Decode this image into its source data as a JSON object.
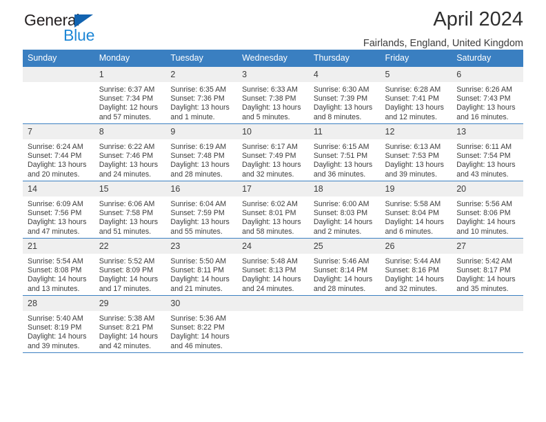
{
  "brand": {
    "line1": "General",
    "line2": "Blue",
    "triangle_icon": "triangle-icon",
    "color_dark": "#231f20",
    "color_blue": "#1e87d6"
  },
  "header": {
    "title": "April 2024",
    "subtitle": "Fairlands, England, United Kingdom"
  },
  "theme": {
    "header_blue": "#3a7fc1",
    "daynum_gray": "#efefef",
    "text": "#3b3b3b"
  },
  "weekday_headers": [
    "Sunday",
    "Monday",
    "Tuesday",
    "Wednesday",
    "Thursday",
    "Friday",
    "Saturday"
  ],
  "weeks": [
    [
      {
        "day": "",
        "sunrise": "",
        "sunset": "",
        "daylight1": "",
        "daylight2": ""
      },
      {
        "day": "1",
        "sunrise": "Sunrise: 6:37 AM",
        "sunset": "Sunset: 7:34 PM",
        "daylight1": "Daylight: 12 hours",
        "daylight2": "and 57 minutes."
      },
      {
        "day": "2",
        "sunrise": "Sunrise: 6:35 AM",
        "sunset": "Sunset: 7:36 PM",
        "daylight1": "Daylight: 13 hours",
        "daylight2": "and 1 minute."
      },
      {
        "day": "3",
        "sunrise": "Sunrise: 6:33 AM",
        "sunset": "Sunset: 7:38 PM",
        "daylight1": "Daylight: 13 hours",
        "daylight2": "and 5 minutes."
      },
      {
        "day": "4",
        "sunrise": "Sunrise: 6:30 AM",
        "sunset": "Sunset: 7:39 PM",
        "daylight1": "Daylight: 13 hours",
        "daylight2": "and 8 minutes."
      },
      {
        "day": "5",
        "sunrise": "Sunrise: 6:28 AM",
        "sunset": "Sunset: 7:41 PM",
        "daylight1": "Daylight: 13 hours",
        "daylight2": "and 12 minutes."
      },
      {
        "day": "6",
        "sunrise": "Sunrise: 6:26 AM",
        "sunset": "Sunset: 7:43 PM",
        "daylight1": "Daylight: 13 hours",
        "daylight2": "and 16 minutes."
      }
    ],
    [
      {
        "day": "7",
        "sunrise": "Sunrise: 6:24 AM",
        "sunset": "Sunset: 7:44 PM",
        "daylight1": "Daylight: 13 hours",
        "daylight2": "and 20 minutes."
      },
      {
        "day": "8",
        "sunrise": "Sunrise: 6:22 AM",
        "sunset": "Sunset: 7:46 PM",
        "daylight1": "Daylight: 13 hours",
        "daylight2": "and 24 minutes."
      },
      {
        "day": "9",
        "sunrise": "Sunrise: 6:19 AM",
        "sunset": "Sunset: 7:48 PM",
        "daylight1": "Daylight: 13 hours",
        "daylight2": "and 28 minutes."
      },
      {
        "day": "10",
        "sunrise": "Sunrise: 6:17 AM",
        "sunset": "Sunset: 7:49 PM",
        "daylight1": "Daylight: 13 hours",
        "daylight2": "and 32 minutes."
      },
      {
        "day": "11",
        "sunrise": "Sunrise: 6:15 AM",
        "sunset": "Sunset: 7:51 PM",
        "daylight1": "Daylight: 13 hours",
        "daylight2": "and 36 minutes."
      },
      {
        "day": "12",
        "sunrise": "Sunrise: 6:13 AM",
        "sunset": "Sunset: 7:53 PM",
        "daylight1": "Daylight: 13 hours",
        "daylight2": "and 39 minutes."
      },
      {
        "day": "13",
        "sunrise": "Sunrise: 6:11 AM",
        "sunset": "Sunset: 7:54 PM",
        "daylight1": "Daylight: 13 hours",
        "daylight2": "and 43 minutes."
      }
    ],
    [
      {
        "day": "14",
        "sunrise": "Sunrise: 6:09 AM",
        "sunset": "Sunset: 7:56 PM",
        "daylight1": "Daylight: 13 hours",
        "daylight2": "and 47 minutes."
      },
      {
        "day": "15",
        "sunrise": "Sunrise: 6:06 AM",
        "sunset": "Sunset: 7:58 PM",
        "daylight1": "Daylight: 13 hours",
        "daylight2": "and 51 minutes."
      },
      {
        "day": "16",
        "sunrise": "Sunrise: 6:04 AM",
        "sunset": "Sunset: 7:59 PM",
        "daylight1": "Daylight: 13 hours",
        "daylight2": "and 55 minutes."
      },
      {
        "day": "17",
        "sunrise": "Sunrise: 6:02 AM",
        "sunset": "Sunset: 8:01 PM",
        "daylight1": "Daylight: 13 hours",
        "daylight2": "and 58 minutes."
      },
      {
        "day": "18",
        "sunrise": "Sunrise: 6:00 AM",
        "sunset": "Sunset: 8:03 PM",
        "daylight1": "Daylight: 14 hours",
        "daylight2": "and 2 minutes."
      },
      {
        "day": "19",
        "sunrise": "Sunrise: 5:58 AM",
        "sunset": "Sunset: 8:04 PM",
        "daylight1": "Daylight: 14 hours",
        "daylight2": "and 6 minutes."
      },
      {
        "day": "20",
        "sunrise": "Sunrise: 5:56 AM",
        "sunset": "Sunset: 8:06 PM",
        "daylight1": "Daylight: 14 hours",
        "daylight2": "and 10 minutes."
      }
    ],
    [
      {
        "day": "21",
        "sunrise": "Sunrise: 5:54 AM",
        "sunset": "Sunset: 8:08 PM",
        "daylight1": "Daylight: 14 hours",
        "daylight2": "and 13 minutes."
      },
      {
        "day": "22",
        "sunrise": "Sunrise: 5:52 AM",
        "sunset": "Sunset: 8:09 PM",
        "daylight1": "Daylight: 14 hours",
        "daylight2": "and 17 minutes."
      },
      {
        "day": "23",
        "sunrise": "Sunrise: 5:50 AM",
        "sunset": "Sunset: 8:11 PM",
        "daylight1": "Daylight: 14 hours",
        "daylight2": "and 21 minutes."
      },
      {
        "day": "24",
        "sunrise": "Sunrise: 5:48 AM",
        "sunset": "Sunset: 8:13 PM",
        "daylight1": "Daylight: 14 hours",
        "daylight2": "and 24 minutes."
      },
      {
        "day": "25",
        "sunrise": "Sunrise: 5:46 AM",
        "sunset": "Sunset: 8:14 PM",
        "daylight1": "Daylight: 14 hours",
        "daylight2": "and 28 minutes."
      },
      {
        "day": "26",
        "sunrise": "Sunrise: 5:44 AM",
        "sunset": "Sunset: 8:16 PM",
        "daylight1": "Daylight: 14 hours",
        "daylight2": "and 32 minutes."
      },
      {
        "day": "27",
        "sunrise": "Sunrise: 5:42 AM",
        "sunset": "Sunset: 8:17 PM",
        "daylight1": "Daylight: 14 hours",
        "daylight2": "and 35 minutes."
      }
    ],
    [
      {
        "day": "28",
        "sunrise": "Sunrise: 5:40 AM",
        "sunset": "Sunset: 8:19 PM",
        "daylight1": "Daylight: 14 hours",
        "daylight2": "and 39 minutes."
      },
      {
        "day": "29",
        "sunrise": "Sunrise: 5:38 AM",
        "sunset": "Sunset: 8:21 PM",
        "daylight1": "Daylight: 14 hours",
        "daylight2": "and 42 minutes."
      },
      {
        "day": "30",
        "sunrise": "Sunrise: 5:36 AM",
        "sunset": "Sunset: 8:22 PM",
        "daylight1": "Daylight: 14 hours",
        "daylight2": "and 46 minutes."
      },
      {
        "day": "",
        "sunrise": "",
        "sunset": "",
        "daylight1": "",
        "daylight2": ""
      },
      {
        "day": "",
        "sunrise": "",
        "sunset": "",
        "daylight1": "",
        "daylight2": ""
      },
      {
        "day": "",
        "sunrise": "",
        "sunset": "",
        "daylight1": "",
        "daylight2": ""
      },
      {
        "day": "",
        "sunrise": "",
        "sunset": "",
        "daylight1": "",
        "daylight2": ""
      }
    ]
  ]
}
